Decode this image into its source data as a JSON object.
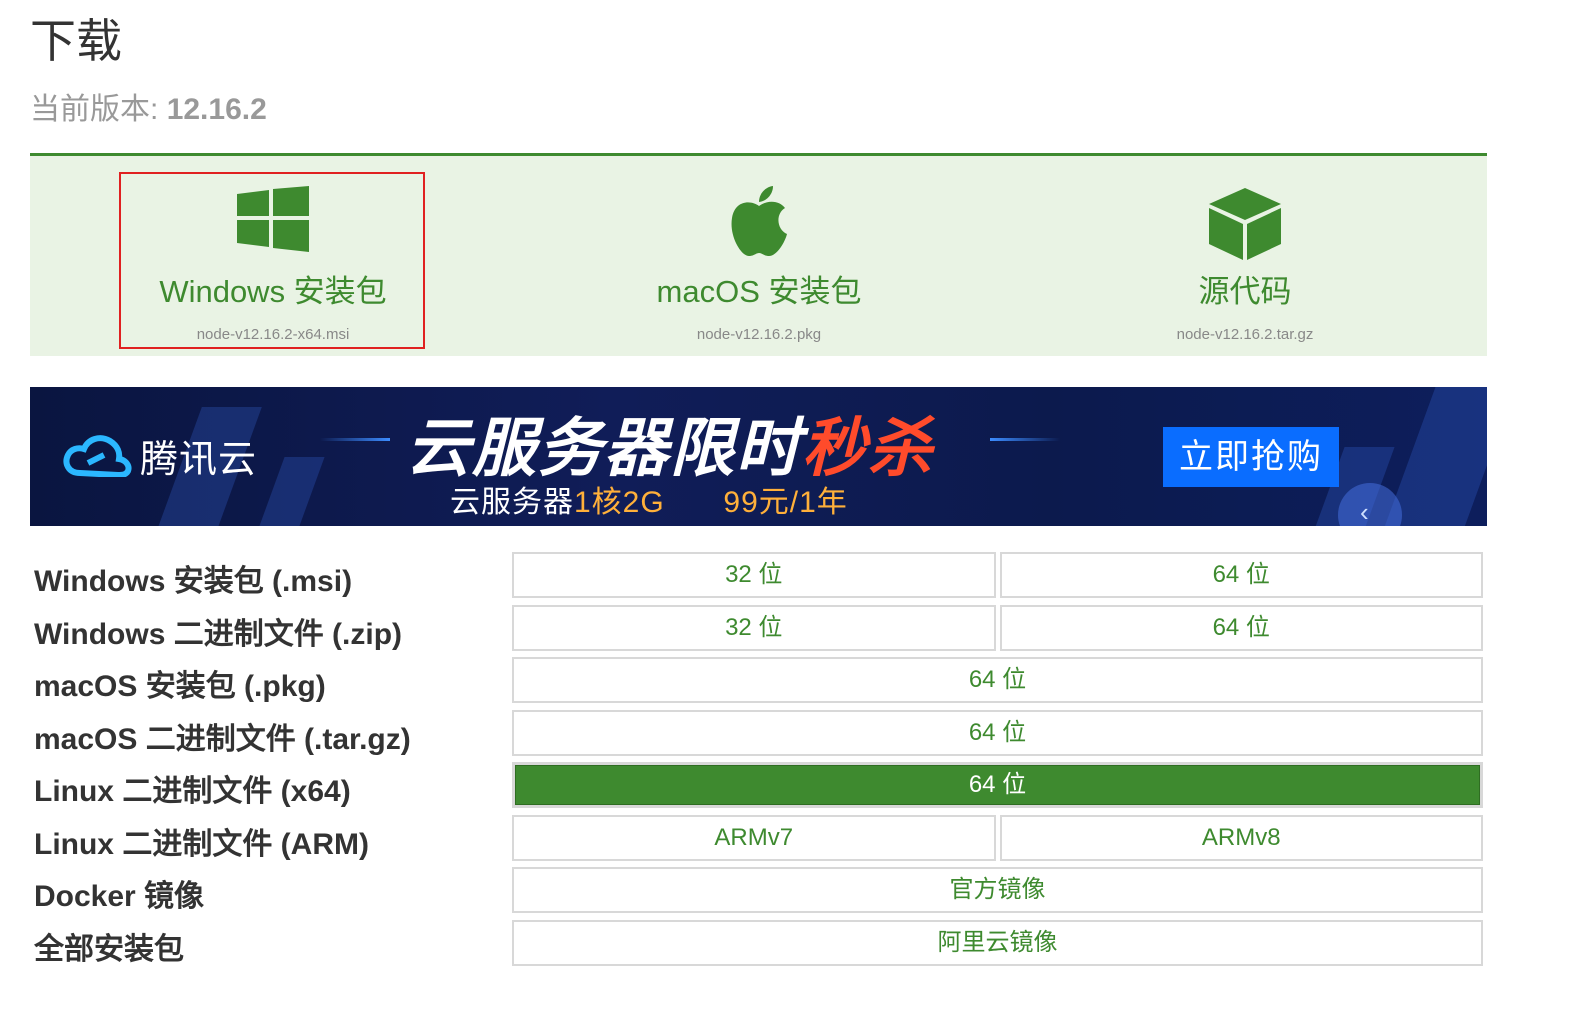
{
  "header": {
    "title": "下载",
    "version_label": "当前版本:",
    "version_value": "12.16.2"
  },
  "tiles": [
    {
      "label": "Windows 安装包",
      "file": "node-v12.16.2-x64.msi",
      "icon": "windows-icon"
    },
    {
      "label": "macOS 安装包",
      "file": "node-v12.16.2.pkg",
      "icon": "apple-icon"
    },
    {
      "label": "源代码",
      "file": "node-v12.16.2.tar.gz",
      "icon": "box-icon"
    }
  ],
  "banner": {
    "logo_text": "腾讯云",
    "headline_main": "云服务器限时",
    "headline_hot": "秒杀",
    "sub_a": "云服务器",
    "sub_b": "1核2G",
    "sub_c": "99元/1年",
    "cta": "立即抢购"
  },
  "downloads": [
    {
      "label": "Windows 安装包 (.msi)",
      "options": [
        "32 位",
        "64 位"
      ]
    },
    {
      "label": "Windows 二进制文件 (.zip)",
      "options": [
        "32 位",
        "64 位"
      ]
    },
    {
      "label": "macOS 安装包 (.pkg)",
      "options": [
        "64 位"
      ]
    },
    {
      "label": "macOS 二进制文件 (.tar.gz)",
      "options": [
        "64 位"
      ]
    },
    {
      "label": "Linux 二进制文件 (x64)",
      "options": [
        "64 位"
      ],
      "active": true
    },
    {
      "label": "Linux 二进制文件 (ARM)",
      "options": [
        "ARMv7",
        "ARMv8"
      ]
    },
    {
      "label": "Docker 镜像",
      "options": [
        "官方镜像"
      ]
    },
    {
      "label": "全部安装包",
      "options": [
        "阿里云镜像"
      ]
    }
  ],
  "colors": {
    "accent": "#3e8a2f",
    "tile_bg": "#e9f3e4",
    "highlight": "#e02020",
    "banner_bg": "#101d58",
    "banner_hot": "#ff4b2b",
    "cta_bg": "#0a6dff"
  }
}
